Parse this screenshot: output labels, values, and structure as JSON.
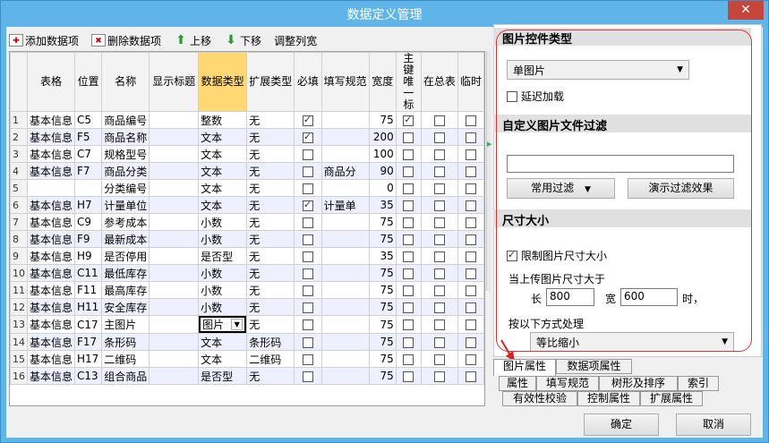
{
  "window": {
    "title": "数据定义管理",
    "close_label": "✕"
  },
  "toolbar": {
    "add_label": "添加数据项",
    "delete_label": "删除数据项",
    "up_label": "上移",
    "down_label": "下移",
    "adjust_label": "调整列宽"
  },
  "grid": {
    "columns": [
      "表格",
      "位置",
      "名称",
      "显示标题",
      "数据类型",
      "扩展类型",
      "必填",
      "填写规范",
      "宽度",
      "主键\n唯一标",
      "在总表",
      "临时"
    ],
    "rows": [
      {
        "n": "1",
        "table": "基本信息",
        "pos": "C5",
        "name": "商品编号",
        "title": "",
        "type": "整数",
        "ext": "无",
        "req": true,
        "rule": "",
        "width": "75",
        "pk": true,
        "tot": false,
        "tmp": false
      },
      {
        "n": "2",
        "table": "基本信息",
        "pos": "F5",
        "name": "商品名称",
        "title": "",
        "type": "文本",
        "ext": "无",
        "req": true,
        "rule": "",
        "width": "200",
        "pk": false,
        "tot": false,
        "tmp": false
      },
      {
        "n": "3",
        "table": "基本信息",
        "pos": "C7",
        "name": "规格型号",
        "title": "",
        "type": "文本",
        "ext": "无",
        "req": false,
        "rule": "",
        "width": "100",
        "pk": false,
        "tot": false,
        "tmp": false
      },
      {
        "n": "4",
        "table": "基本信息",
        "pos": "F7",
        "name": "商品分类",
        "title": "",
        "type": "文本",
        "ext": "无",
        "req": false,
        "rule": "商品分",
        "width": "90",
        "pk": false,
        "tot": false,
        "tmp": false
      },
      {
        "n": "5",
        "table": "",
        "pos": "",
        "name": "分类编号",
        "title": "",
        "type": "文本",
        "ext": "无",
        "req": false,
        "rule": "",
        "width": "0",
        "pk": false,
        "tot": false,
        "tmp": false
      },
      {
        "n": "6",
        "table": "基本信息",
        "pos": "H7",
        "name": "计量单位",
        "title": "",
        "type": "文本",
        "ext": "无",
        "req": true,
        "rule": "计量单",
        "width": "35",
        "pk": false,
        "tot": false,
        "tmp": false
      },
      {
        "n": "7",
        "table": "基本信息",
        "pos": "C9",
        "name": "参考成本",
        "title": "",
        "type": "小数",
        "ext": "无",
        "req": false,
        "rule": "",
        "width": "75",
        "pk": false,
        "tot": false,
        "tmp": false
      },
      {
        "n": "8",
        "table": "基本信息",
        "pos": "F9",
        "name": "最新成本",
        "title": "",
        "type": "小数",
        "ext": "无",
        "req": false,
        "rule": "",
        "width": "75",
        "pk": false,
        "tot": false,
        "tmp": false
      },
      {
        "n": "9",
        "table": "基本信息",
        "pos": "H9",
        "name": "是否停用",
        "title": "",
        "type": "是否型",
        "ext": "无",
        "req": false,
        "rule": "",
        "width": "35",
        "pk": false,
        "tot": false,
        "tmp": false
      },
      {
        "n": "10",
        "table": "基本信息",
        "pos": "C11",
        "name": "最低库存",
        "title": "",
        "type": "小数",
        "ext": "无",
        "req": false,
        "rule": "",
        "width": "75",
        "pk": false,
        "tot": false,
        "tmp": false
      },
      {
        "n": "11",
        "table": "基本信息",
        "pos": "F11",
        "name": "最高库存",
        "title": "",
        "type": "小数",
        "ext": "无",
        "req": false,
        "rule": "",
        "width": "75",
        "pk": false,
        "tot": false,
        "tmp": false
      },
      {
        "n": "12",
        "table": "基本信息",
        "pos": "H11",
        "name": "安全库存",
        "title": "",
        "type": "小数",
        "ext": "无",
        "req": false,
        "rule": "",
        "width": "75",
        "pk": false,
        "tot": false,
        "tmp": false
      },
      {
        "n": "13",
        "table": "基本信息",
        "pos": "C17",
        "name": "主图片",
        "title": "",
        "type": "图片",
        "ext": "无",
        "req": false,
        "rule": "",
        "width": "75",
        "pk": false,
        "tot": false,
        "tmp": false
      },
      {
        "n": "14",
        "table": "基本信息",
        "pos": "F17",
        "name": "条形码",
        "title": "",
        "type": "文本",
        "ext": "条形码",
        "req": false,
        "rule": "",
        "width": "75",
        "pk": false,
        "tot": false,
        "tmp": false
      },
      {
        "n": "15",
        "table": "基本信息",
        "pos": "H17",
        "name": "二维码",
        "title": "",
        "type": "文本",
        "ext": "二维码",
        "req": false,
        "rule": "",
        "width": "75",
        "pk": false,
        "tot": false,
        "tmp": false
      },
      {
        "n": "16",
        "table": "基本信息",
        "pos": "C13",
        "name": "组合商品",
        "title": "",
        "type": "是否型",
        "ext": "无",
        "req": false,
        "rule": "",
        "width": "75",
        "pk": false,
        "tot": false,
        "tmp": false
      }
    ]
  },
  "panel": {
    "img_type_header": "图片控件类型",
    "img_type_value": "单图片",
    "lazy_load_label": "延迟加载",
    "filter_header": "自定义图片文件过滤",
    "filter_value": "",
    "common_filter_label": "常用过滤",
    "demo_filter_label": "演示过滤效果",
    "size_header": "尺寸大小",
    "limit_size_label": "限制图片尺寸大小",
    "upload_exceed_label": "当上传图片尺寸大于",
    "length_label": "长",
    "length_value": "800",
    "width_label": "宽",
    "width_value": "600",
    "when_label": "时，",
    "process_label": "按以下方式处理",
    "process_value": "等比缩小"
  },
  "tabs": {
    "row1": [
      "图片属性",
      "数据项属性"
    ],
    "row2": [
      "属性",
      "填写规范",
      "树形及排序",
      "索引"
    ],
    "row3": [
      "有效性校验",
      "控制属性",
      "扩展属性"
    ]
  },
  "buttons": {
    "ok": "确定",
    "cancel": "取消"
  }
}
